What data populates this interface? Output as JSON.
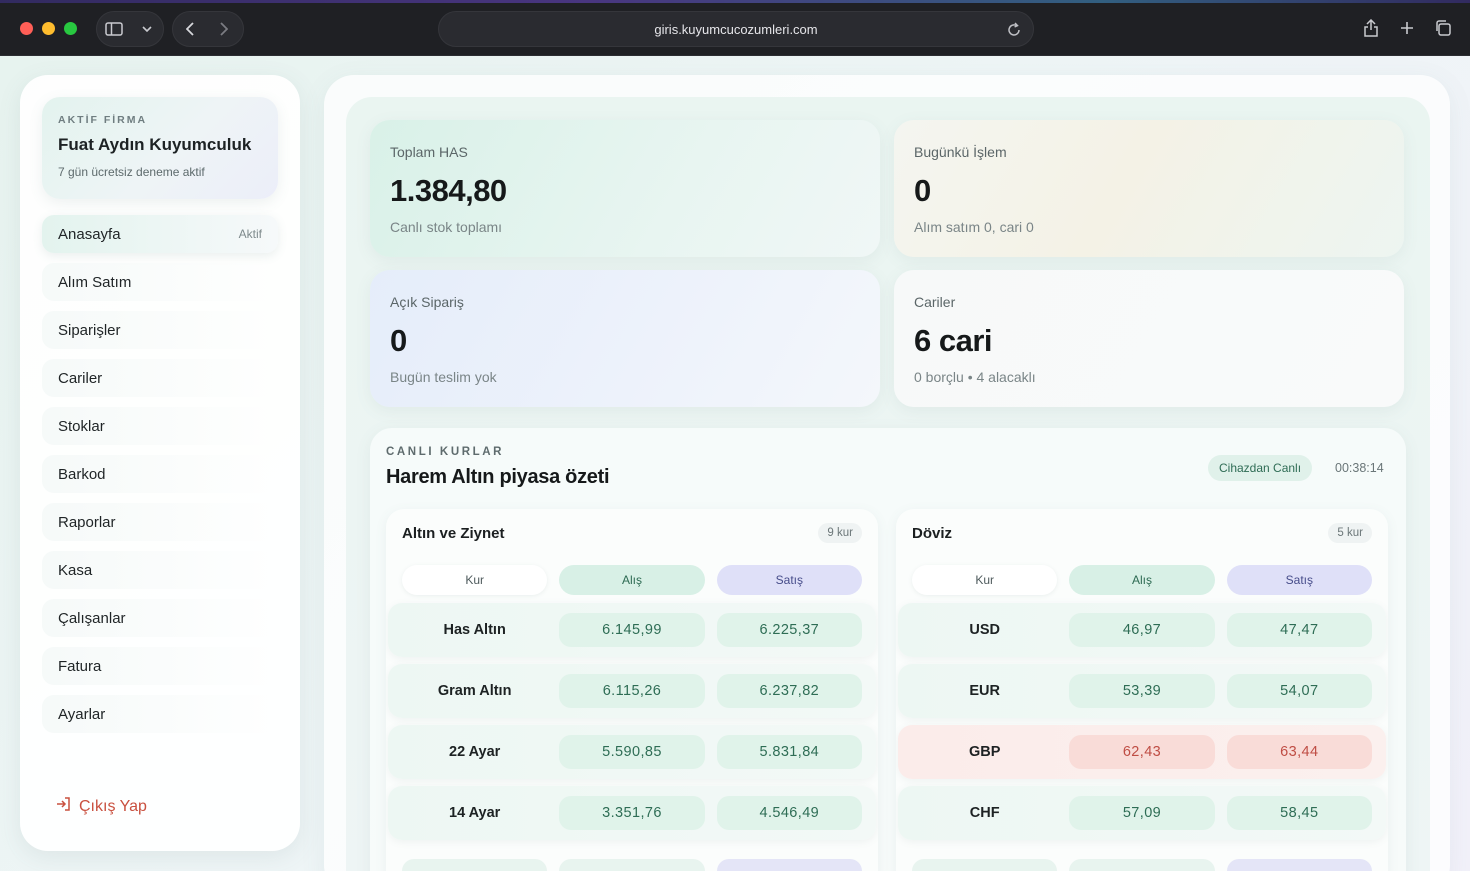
{
  "browser": {
    "url": "giris.kuyumcucozumleri.com"
  },
  "sidebar": {
    "firm_label": "AKTİF FİRMA",
    "firm_name": "Fuat Aydın Kuyumculuk",
    "trial": "7 gün ücretsiz deneme aktif",
    "items": [
      {
        "label": "Anasayfa",
        "badge": "Aktif"
      },
      {
        "label": "Alım Satım"
      },
      {
        "label": "Siparişler"
      },
      {
        "label": "Cariler"
      },
      {
        "label": "Stoklar"
      },
      {
        "label": "Barkod"
      },
      {
        "label": "Raporlar"
      },
      {
        "label": "Kasa"
      },
      {
        "label": "Çalışanlar"
      },
      {
        "label": "Fatura"
      },
      {
        "label": "Ayarlar"
      }
    ],
    "logout": "Çıkış Yap"
  },
  "stats": {
    "total_has": {
      "title": "Toplam HAS",
      "value": "1.384,80",
      "sub": "Canlı stok toplamı"
    },
    "today": {
      "title": "Bugünkü İşlem",
      "value": "0",
      "sub": "Alım satım 0, cari 0"
    },
    "orders": {
      "title": "Açık Sipariş",
      "value": "0",
      "sub": "Bugün teslim yok"
    },
    "accounts": {
      "title": "Cariler",
      "value": "6 cari",
      "sub": "0 borçlu • 4 alacaklı"
    }
  },
  "rates": {
    "kicker": "CANLI KURLAR",
    "title": "Harem Altın piyasa özeti",
    "live": "Cihazdan Canlı",
    "time": "00:38:14",
    "columns": {
      "kur": "Kur",
      "alis": "Alış",
      "satis": "Satış"
    },
    "gold": {
      "title": "Altın ve Ziynet",
      "count": "9 kur",
      "rows": [
        {
          "name": "Has Altın",
          "alis": "6.145,99",
          "satis": "6.225,37"
        },
        {
          "name": "Gram Altın",
          "alis": "6.115,26",
          "satis": "6.237,82"
        },
        {
          "name": "22 Ayar",
          "alis": "5.590,85",
          "satis": "5.831,84"
        },
        {
          "name": "14 Ayar",
          "alis": "3.351,76",
          "satis": "4.546,49"
        }
      ]
    },
    "fx": {
      "title": "Döviz",
      "count": "5 kur",
      "rows": [
        {
          "name": "USD",
          "alis": "46,97",
          "satis": "47,47"
        },
        {
          "name": "EUR",
          "alis": "53,39",
          "satis": "54,07"
        },
        {
          "name": "GBP",
          "alis": "62,43",
          "satis": "63,44"
        },
        {
          "name": "CHF",
          "alis": "57,09",
          "satis": "58,45"
        }
      ]
    }
  }
}
